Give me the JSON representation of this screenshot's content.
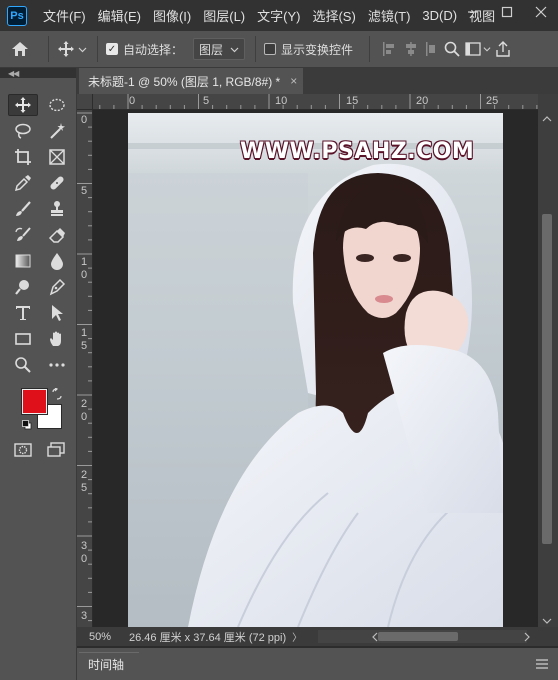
{
  "app": {
    "logo": "Ps"
  },
  "menu": [
    "文件(F)",
    "编辑(E)",
    "图像(I)",
    "图层(L)",
    "文字(Y)",
    "选择(S)",
    "滤镜(T)",
    "3D(D)",
    "视图"
  ],
  "window_controls": [
    "minimize-icon",
    "maximize-icon",
    "close-icon"
  ],
  "options_bar": {
    "auto_select_label": "自动选择：",
    "auto_select_checked": true,
    "auto_select_target": "图层",
    "show_transform_label": "显示变换控件",
    "show_transform_checked": false
  },
  "document": {
    "tab_title": "未标题-1 @ 50% (图层 1, RGB/8#) *",
    "close": "×",
    "watermark": "WWW.PSAHZ.COM"
  },
  "rulers": {
    "horizontal": [
      "0",
      "5",
      "10",
      "15",
      "20",
      "25"
    ],
    "vertical": [
      "0",
      "5",
      "10",
      "15",
      "20",
      "25",
      "30",
      "3"
    ]
  },
  "status": {
    "zoom": "50%",
    "doc_size": "26.46 厘米 x 37.64 厘米 (72 ppi)",
    "arrow": "〉"
  },
  "timeline": {
    "label": "时间轴"
  },
  "colors": {
    "foreground": "#e0101a",
    "background": "#ffffff",
    "app_bg": "#535353",
    "menubar_bg": "#323232"
  },
  "tools": [
    "move-tool-icon",
    "marquee-tool-icon",
    "lasso-tool-icon",
    "magic-wand-tool-icon",
    "crop-tool-icon",
    "frame-tool-icon",
    "eyedropper-tool-icon",
    "healing-brush-tool-icon",
    "brush-tool-icon",
    "clone-stamp-tool-icon",
    "history-brush-tool-icon",
    "eraser-tool-icon",
    "gradient-tool-icon",
    "blur-tool-icon",
    "dodge-tool-icon",
    "pen-tool-icon",
    "type-tool-icon",
    "path-selection-tool-icon",
    "rectangle-tool-icon",
    "hand-tool-icon",
    "zoom-tool-icon",
    "more-tools-icon"
  ]
}
